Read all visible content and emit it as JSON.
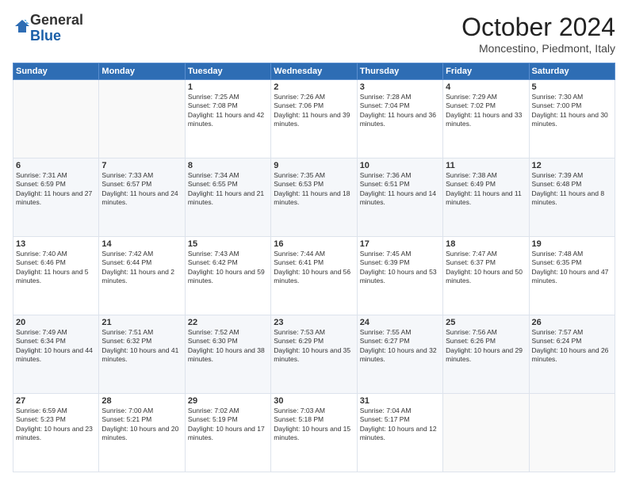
{
  "logo": {
    "general": "General",
    "blue": "Blue"
  },
  "title": "October 2024",
  "location": "Moncestino, Piedmont, Italy",
  "days_of_week": [
    "Sunday",
    "Monday",
    "Tuesday",
    "Wednesday",
    "Thursday",
    "Friday",
    "Saturday"
  ],
  "weeks": [
    [
      {
        "day": "",
        "sunrise": "",
        "sunset": "",
        "daylight": ""
      },
      {
        "day": "",
        "sunrise": "",
        "sunset": "",
        "daylight": ""
      },
      {
        "day": "1",
        "sunrise": "Sunrise: 7:25 AM",
        "sunset": "Sunset: 7:08 PM",
        "daylight": "Daylight: 11 hours and 42 minutes."
      },
      {
        "day": "2",
        "sunrise": "Sunrise: 7:26 AM",
        "sunset": "Sunset: 7:06 PM",
        "daylight": "Daylight: 11 hours and 39 minutes."
      },
      {
        "day": "3",
        "sunrise": "Sunrise: 7:28 AM",
        "sunset": "Sunset: 7:04 PM",
        "daylight": "Daylight: 11 hours and 36 minutes."
      },
      {
        "day": "4",
        "sunrise": "Sunrise: 7:29 AM",
        "sunset": "Sunset: 7:02 PM",
        "daylight": "Daylight: 11 hours and 33 minutes."
      },
      {
        "day": "5",
        "sunrise": "Sunrise: 7:30 AM",
        "sunset": "Sunset: 7:00 PM",
        "daylight": "Daylight: 11 hours and 30 minutes."
      }
    ],
    [
      {
        "day": "6",
        "sunrise": "Sunrise: 7:31 AM",
        "sunset": "Sunset: 6:59 PM",
        "daylight": "Daylight: 11 hours and 27 minutes."
      },
      {
        "day": "7",
        "sunrise": "Sunrise: 7:33 AM",
        "sunset": "Sunset: 6:57 PM",
        "daylight": "Daylight: 11 hours and 24 minutes."
      },
      {
        "day": "8",
        "sunrise": "Sunrise: 7:34 AM",
        "sunset": "Sunset: 6:55 PM",
        "daylight": "Daylight: 11 hours and 21 minutes."
      },
      {
        "day": "9",
        "sunrise": "Sunrise: 7:35 AM",
        "sunset": "Sunset: 6:53 PM",
        "daylight": "Daylight: 11 hours and 18 minutes."
      },
      {
        "day": "10",
        "sunrise": "Sunrise: 7:36 AM",
        "sunset": "Sunset: 6:51 PM",
        "daylight": "Daylight: 11 hours and 14 minutes."
      },
      {
        "day": "11",
        "sunrise": "Sunrise: 7:38 AM",
        "sunset": "Sunset: 6:49 PM",
        "daylight": "Daylight: 11 hours and 11 minutes."
      },
      {
        "day": "12",
        "sunrise": "Sunrise: 7:39 AM",
        "sunset": "Sunset: 6:48 PM",
        "daylight": "Daylight: 11 hours and 8 minutes."
      }
    ],
    [
      {
        "day": "13",
        "sunrise": "Sunrise: 7:40 AM",
        "sunset": "Sunset: 6:46 PM",
        "daylight": "Daylight: 11 hours and 5 minutes."
      },
      {
        "day": "14",
        "sunrise": "Sunrise: 7:42 AM",
        "sunset": "Sunset: 6:44 PM",
        "daylight": "Daylight: 11 hours and 2 minutes."
      },
      {
        "day": "15",
        "sunrise": "Sunrise: 7:43 AM",
        "sunset": "Sunset: 6:42 PM",
        "daylight": "Daylight: 10 hours and 59 minutes."
      },
      {
        "day": "16",
        "sunrise": "Sunrise: 7:44 AM",
        "sunset": "Sunset: 6:41 PM",
        "daylight": "Daylight: 10 hours and 56 minutes."
      },
      {
        "day": "17",
        "sunrise": "Sunrise: 7:45 AM",
        "sunset": "Sunset: 6:39 PM",
        "daylight": "Daylight: 10 hours and 53 minutes."
      },
      {
        "day": "18",
        "sunrise": "Sunrise: 7:47 AM",
        "sunset": "Sunset: 6:37 PM",
        "daylight": "Daylight: 10 hours and 50 minutes."
      },
      {
        "day": "19",
        "sunrise": "Sunrise: 7:48 AM",
        "sunset": "Sunset: 6:35 PM",
        "daylight": "Daylight: 10 hours and 47 minutes."
      }
    ],
    [
      {
        "day": "20",
        "sunrise": "Sunrise: 7:49 AM",
        "sunset": "Sunset: 6:34 PM",
        "daylight": "Daylight: 10 hours and 44 minutes."
      },
      {
        "day": "21",
        "sunrise": "Sunrise: 7:51 AM",
        "sunset": "Sunset: 6:32 PM",
        "daylight": "Daylight: 10 hours and 41 minutes."
      },
      {
        "day": "22",
        "sunrise": "Sunrise: 7:52 AM",
        "sunset": "Sunset: 6:30 PM",
        "daylight": "Daylight: 10 hours and 38 minutes."
      },
      {
        "day": "23",
        "sunrise": "Sunrise: 7:53 AM",
        "sunset": "Sunset: 6:29 PM",
        "daylight": "Daylight: 10 hours and 35 minutes."
      },
      {
        "day": "24",
        "sunrise": "Sunrise: 7:55 AM",
        "sunset": "Sunset: 6:27 PM",
        "daylight": "Daylight: 10 hours and 32 minutes."
      },
      {
        "day": "25",
        "sunrise": "Sunrise: 7:56 AM",
        "sunset": "Sunset: 6:26 PM",
        "daylight": "Daylight: 10 hours and 29 minutes."
      },
      {
        "day": "26",
        "sunrise": "Sunrise: 7:57 AM",
        "sunset": "Sunset: 6:24 PM",
        "daylight": "Daylight: 10 hours and 26 minutes."
      }
    ],
    [
      {
        "day": "27",
        "sunrise": "Sunrise: 6:59 AM",
        "sunset": "Sunset: 5:23 PM",
        "daylight": "Daylight: 10 hours and 23 minutes."
      },
      {
        "day": "28",
        "sunrise": "Sunrise: 7:00 AM",
        "sunset": "Sunset: 5:21 PM",
        "daylight": "Daylight: 10 hours and 20 minutes."
      },
      {
        "day": "29",
        "sunrise": "Sunrise: 7:02 AM",
        "sunset": "Sunset: 5:19 PM",
        "daylight": "Daylight: 10 hours and 17 minutes."
      },
      {
        "day": "30",
        "sunrise": "Sunrise: 7:03 AM",
        "sunset": "Sunset: 5:18 PM",
        "daylight": "Daylight: 10 hours and 15 minutes."
      },
      {
        "day": "31",
        "sunrise": "Sunrise: 7:04 AM",
        "sunset": "Sunset: 5:17 PM",
        "daylight": "Daylight: 10 hours and 12 minutes."
      },
      {
        "day": "",
        "sunrise": "",
        "sunset": "",
        "daylight": ""
      },
      {
        "day": "",
        "sunrise": "",
        "sunset": "",
        "daylight": ""
      }
    ]
  ]
}
